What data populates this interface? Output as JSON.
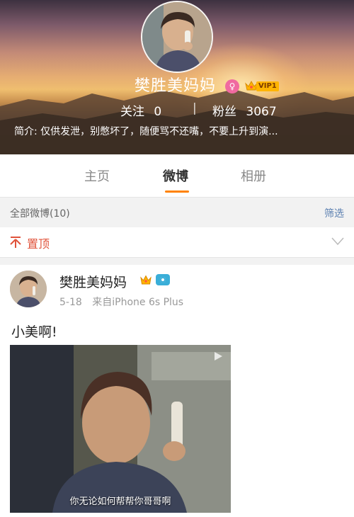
{
  "profile": {
    "username": "樊胜美妈妈",
    "gender_icon": "female-icon",
    "vip_label": "VIP1",
    "follow_label": "关注",
    "follow_count": "0",
    "separator": "|",
    "fans_label": "粉丝",
    "fans_count": "3067",
    "bio": "简介: 仅供发泄，别憋坏了，随便骂不还嘴，不要上升到演..."
  },
  "tabs": [
    {
      "label": "主页",
      "active": false
    },
    {
      "label": "微博",
      "active": true
    },
    {
      "label": "相册",
      "active": false
    }
  ],
  "filter": {
    "label": "全部微博(10)",
    "action": "筛选"
  },
  "pinned": {
    "label": "置顶"
  },
  "post": {
    "author": "樊胜美妈妈",
    "date": "5-18",
    "source": "来自iPhone 6s Plus",
    "text": "小美啊!",
    "video_subtitle": "你无论如何帮帮你哥哥啊"
  },
  "colors": {
    "accent": "#ff8200",
    "pin_red": "#e0533b",
    "link_blue": "#5a7fb0",
    "vip_gold": "#ffb400"
  }
}
